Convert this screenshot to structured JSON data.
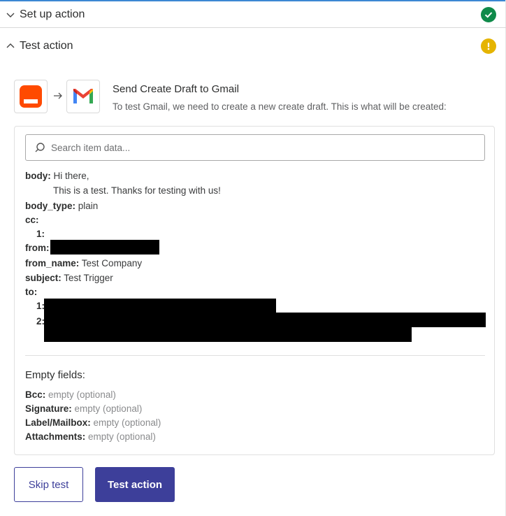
{
  "sections": {
    "setup": {
      "title": "Set up action",
      "status": "complete"
    },
    "test": {
      "title": "Test action",
      "status": "warning"
    }
  },
  "colors": {
    "accent": "#3d3f9a",
    "success": "#0f8a4a",
    "warning": "#e5b400",
    "trigger_app": "#ff4a00"
  },
  "action": {
    "title": "Send Create Draft to Gmail",
    "description": "To test Gmail, we need to create a new create draft. This is what will be created:",
    "from_app_icon": "orange-app-icon",
    "to_app_icon": "gmail-icon"
  },
  "search": {
    "placeholder": "Search item data..."
  },
  "fields": {
    "body_key": "body:",
    "body_line1": "Hi there,",
    "body_line2": "This is a test. Thanks for testing with us!",
    "body_type_key": "body_type:",
    "body_type_val": "plain",
    "cc_key": "cc:",
    "cc_1_key": "1:",
    "from_key": "from:",
    "from_name_key": "from_name:",
    "from_name_val": "Test Company",
    "subject_key": "subject:",
    "subject_val": "Test Trigger",
    "to_key": "to:",
    "to_1_key": "1:",
    "to_2_key": "2:"
  },
  "empty_fields": {
    "heading": "Empty fields:",
    "items": [
      {
        "label": "Bcc:",
        "value": "empty (optional)"
      },
      {
        "label": "Signature:",
        "value": "empty (optional)"
      },
      {
        "label": "Label/Mailbox:",
        "value": "empty (optional)"
      },
      {
        "label": "Attachments:",
        "value": "empty (optional)"
      }
    ]
  },
  "buttons": {
    "skip": "Skip test",
    "test": "Test action"
  }
}
